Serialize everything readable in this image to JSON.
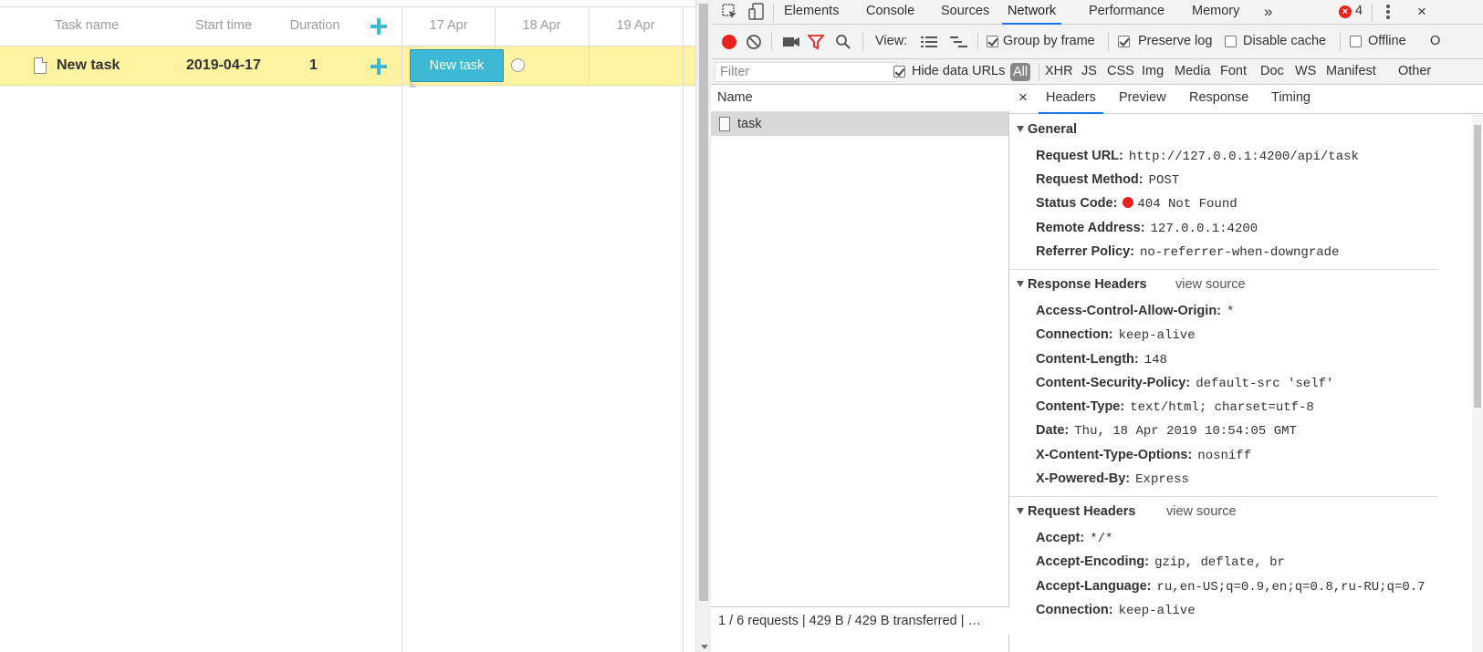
{
  "gantt": {
    "columns": [
      "Task name",
      "Start time",
      "Duration"
    ],
    "dates": [
      "17 Apr",
      "18 Apr",
      "19 Apr"
    ],
    "row": {
      "name": "New task",
      "start": "2019-04-17",
      "duration": "1"
    },
    "bar_label": "New task",
    "accent": "#3db9d3",
    "selected_row_color": "#fff3a1"
  },
  "devtools": {
    "tabs": [
      "Elements",
      "Console",
      "Sources",
      "Network",
      "Performance",
      "Memory"
    ],
    "more_tabs": "»",
    "error_count": "4",
    "toolbar": {
      "view_label": "View:",
      "group_by_frame": "Group by frame",
      "preserve_log": "Preserve log",
      "disable_cache": "Disable cache",
      "offline": "Offline",
      "overflow": "O"
    },
    "filterbar": {
      "placeholder": "Filter",
      "hide_data_urls": "Hide data URLs",
      "types": [
        "All",
        "XHR",
        "JS",
        "CSS",
        "Img",
        "Media",
        "Font",
        "Doc",
        "WS",
        "Manifest",
        "Other"
      ]
    },
    "name_pane": {
      "header": "Name",
      "request": "task",
      "status": "1 / 6 requests  |  429 B / 429 B transferred  | …"
    },
    "detail_tabs": [
      "Headers",
      "Preview",
      "Response",
      "Timing"
    ],
    "close_glyph": "×",
    "general": {
      "title": "General",
      "rows": [
        {
          "k": "Request URL:",
          "v": "http://127.0.0.1:4200/api/task"
        },
        {
          "k": "Request Method:",
          "v": "POST"
        },
        {
          "k": "Status Code:",
          "v": "404 Not Found"
        },
        {
          "k": "Remote Address:",
          "v": "127.0.0.1:4200"
        },
        {
          "k": "Referrer Policy:",
          "v": "no-referrer-when-downgrade"
        }
      ]
    },
    "response_headers": {
      "title": "Response Headers",
      "view_source": "view source",
      "rows": [
        {
          "k": "Access-Control-Allow-Origin:",
          "v": "*"
        },
        {
          "k": "Connection:",
          "v": "keep-alive"
        },
        {
          "k": "Content-Length:",
          "v": "148"
        },
        {
          "k": "Content-Security-Policy:",
          "v": "default-src 'self'"
        },
        {
          "k": "Content-Type:",
          "v": "text/html; charset=utf-8"
        },
        {
          "k": "Date:",
          "v": "Thu, 18 Apr 2019 10:54:05 GMT"
        },
        {
          "k": "X-Content-Type-Options:",
          "v": "nosniff"
        },
        {
          "k": "X-Powered-By:",
          "v": "Express"
        }
      ]
    },
    "request_headers": {
      "title": "Request Headers",
      "view_source": "view source",
      "rows": [
        {
          "k": "Accept:",
          "v": "*/*"
        },
        {
          "k": "Accept-Encoding:",
          "v": "gzip, deflate, br"
        },
        {
          "k": "Accept-Language:",
          "v": "ru,en-US;q=0.9,en;q=0.8,ru-RU;q=0.7"
        },
        {
          "k": "Connection:",
          "v": "keep-alive"
        }
      ]
    },
    "colors": {
      "active_tab": "#1a73e8",
      "record": "#e8231d",
      "filter_icon": "#e8231d"
    }
  }
}
